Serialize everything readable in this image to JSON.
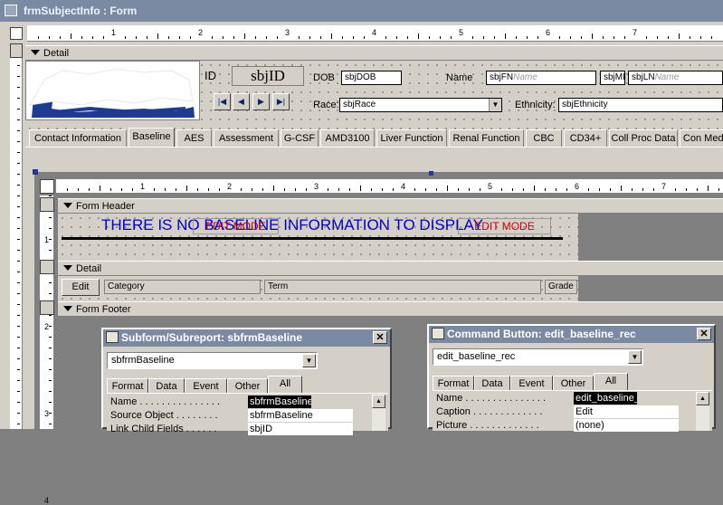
{
  "window": {
    "title": "frmSubjectInfo : Form"
  },
  "colors": {
    "accent": "#0000cc",
    "warning": "#cc0000",
    "title_bar": "#7b8aa3"
  },
  "outer_ruler": [
    "1",
    "2",
    "3",
    "4",
    "5",
    "6",
    "7"
  ],
  "inner_ruler": [
    "1",
    "2",
    "3",
    "4",
    "5",
    "6",
    "7"
  ],
  "vertical_ruler": [
    "1",
    "2",
    "3",
    "4"
  ],
  "sections": {
    "detail": "Detail"
  },
  "header_fields": {
    "id_label": "ID",
    "id_value": "sbjID",
    "dob_label": "DOB",
    "dob_value": "sbjDOB",
    "name_label": "Name",
    "fn_value": "sbjFN",
    "fn_placeholder": "Name",
    "mi_value": "sbjMI",
    "ln_value": "sbjLN",
    "ln_placeholder": "Name",
    "race_label": "Race:",
    "race_value": "sbjRace",
    "ethnicity_label": "Ethnicity:",
    "ethnicity_value": "sbjEthnicity"
  },
  "nav_buttons": [
    "first",
    "previous",
    "next",
    "last"
  ],
  "tabs": [
    "Contact Information",
    "Baseline",
    "AES",
    "Assessment",
    "G-CSF",
    "AMD3100",
    "Liver Function",
    "Renal Function",
    "CBC",
    "CD34+",
    "Coll Proc Data",
    "Con Meds"
  ],
  "subform": {
    "form_header": "Form Header",
    "message": "THERE IS NO BASELINE INFORMATION TO DISPLAY",
    "edit_mode_left": "EDIT MODE",
    "edit_mode_right": "EDIT MODE",
    "detail": "Detail",
    "edit_button": "Edit",
    "category": "Category",
    "term": "Term",
    "grade": "Grade",
    "form_footer": "Form Footer"
  },
  "dialog_subform": {
    "title": "Subform/Subreport: sbfrmBaseline",
    "combo": "sbfrmBaseline",
    "tabs": [
      "Format",
      "Data",
      "Event",
      "Other",
      "All"
    ],
    "active_tab": "All",
    "props": [
      {
        "name": "Name . . . . . . . . . . . . . . .",
        "value": "sbfrmBaseline"
      },
      {
        "name": "Source Object . . . . . . . .",
        "value": "sbfrmBaseline"
      },
      {
        "name": "Link Child Fields . . . . . .",
        "value": "sbjID"
      }
    ]
  },
  "dialog_command": {
    "title": "Command Button: edit_baseline_rec",
    "combo": "edit_baseline_rec",
    "tabs": [
      "Format",
      "Data",
      "Event",
      "Other",
      "All"
    ],
    "active_tab": "All",
    "props": [
      {
        "name": "Name . . . . . . . . . . . . . . .",
        "value": "edit_baseline_rec"
      },
      {
        "name": "Caption . . . . . . . . . . . . .",
        "value": "Edit"
      },
      {
        "name": "Picture . . . . . . . . . . . . .",
        "value": "(none)"
      }
    ]
  }
}
